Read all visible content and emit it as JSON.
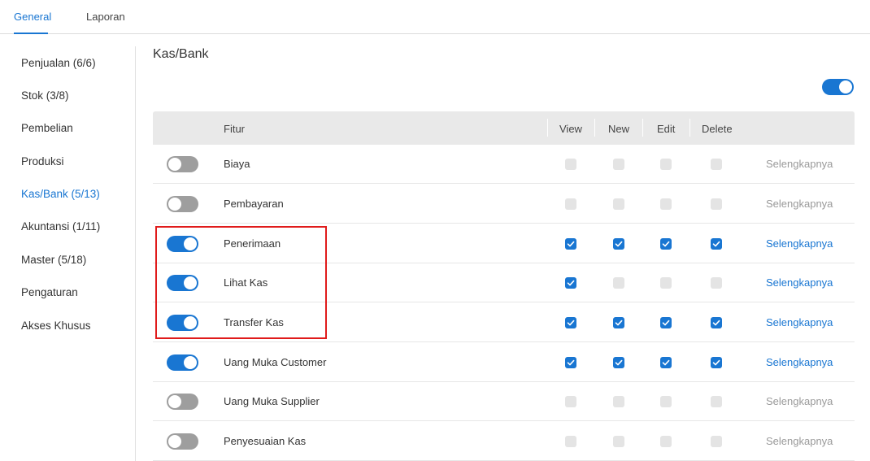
{
  "tabs": [
    {
      "label": "General",
      "active": true
    },
    {
      "label": "Laporan",
      "active": false
    }
  ],
  "sidebar": {
    "items": [
      {
        "label": "Penjualan (6/6)",
        "active": false
      },
      {
        "label": "Stok (3/8)",
        "active": false
      },
      {
        "label": "Pembelian",
        "active": false
      },
      {
        "label": "Produksi",
        "active": false
      },
      {
        "label": "Kas/Bank (5/13)",
        "active": true
      },
      {
        "label": "Akuntansi (1/11)",
        "active": false
      },
      {
        "label": "Master (5/18)",
        "active": false
      },
      {
        "label": "Pengaturan",
        "active": false
      },
      {
        "label": "Akses Khusus",
        "active": false
      }
    ]
  },
  "section": {
    "title": "Kas/Bank",
    "master_toggle_on": true
  },
  "table": {
    "headers": {
      "feature": "Fitur",
      "view": "View",
      "new": "New",
      "edit": "Edit",
      "delete": "Delete"
    },
    "rows": [
      {
        "label": "Biaya",
        "enabled": false,
        "view": false,
        "new": false,
        "edit": false,
        "delete": false,
        "more": "Selengkapnya"
      },
      {
        "label": "Pembayaran",
        "enabled": false,
        "view": false,
        "new": false,
        "edit": false,
        "delete": false,
        "more": "Selengkapnya"
      },
      {
        "label": "Penerimaan",
        "enabled": true,
        "view": true,
        "new": true,
        "edit": true,
        "delete": true,
        "more": "Selengkapnya"
      },
      {
        "label": "Lihat Kas",
        "enabled": true,
        "view": true,
        "new": false,
        "edit": false,
        "delete": false,
        "more": "Selengkapnya"
      },
      {
        "label": "Transfer Kas",
        "enabled": true,
        "view": true,
        "new": true,
        "edit": true,
        "delete": true,
        "more": "Selengkapnya"
      },
      {
        "label": "Uang Muka Customer",
        "enabled": true,
        "view": true,
        "new": true,
        "edit": true,
        "delete": true,
        "more": "Selengkapnya"
      },
      {
        "label": "Uang Muka Supplier",
        "enabled": false,
        "view": false,
        "new": false,
        "edit": false,
        "delete": false,
        "more": "Selengkapnya"
      },
      {
        "label": "Penyesuaian Kas",
        "enabled": false,
        "view": false,
        "new": false,
        "edit": false,
        "delete": false,
        "more": "Selengkapnya"
      }
    ]
  },
  "colors": {
    "accent": "#1976d2",
    "toggle_off": "#9e9e9e",
    "highlight": "#e01b1b"
  }
}
